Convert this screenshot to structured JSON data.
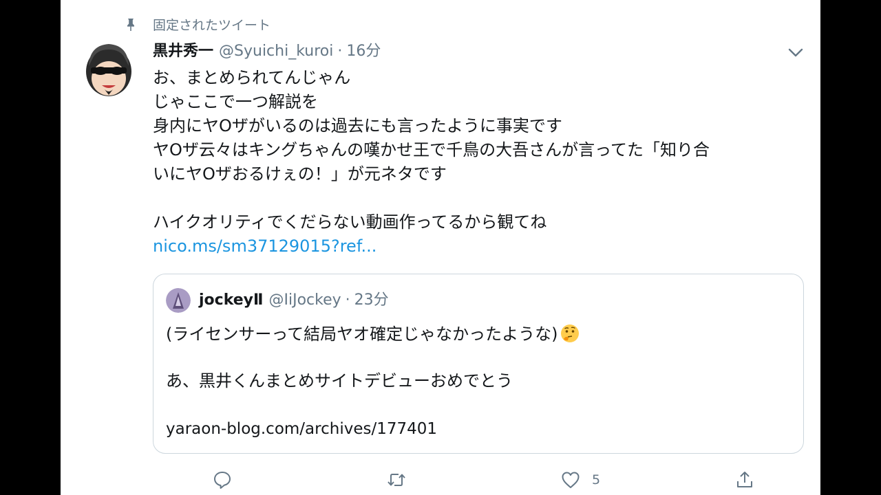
{
  "pinned_label": "固定されたツイート",
  "tweet": {
    "author_name": "黒井秀一",
    "author_handle": "@Syuichi_kuroi",
    "separator": "·",
    "time": "16分",
    "lines": [
      "お、まとめられてんじゃん",
      "じゃここで一つ解説を",
      "身内にヤOザがいるのは過去にも言ったように事実です",
      "ヤOザ云々はキングちゃんの嘆かせ王で千鳥の大吾さんが言ってた「知り合",
      "いにヤOザおるけぇの！」が元ネタです"
    ],
    "lines2": [
      "ハイクオリティでくだらない動画作ってるから観てね"
    ],
    "link": "nico.ms/sm37129015?ref..."
  },
  "quote": {
    "author_name": "jockeyⅡ",
    "author_handle": "@IiJockey",
    "separator": "·",
    "time": "23分",
    "line1": "(ライセンサーって結局ヤオ確定じゃなかったような)",
    "line1_emoji": "thinking-face-emoji",
    "line2": "あ、黒井くんまとめサイトデビューおめでとう",
    "url": "yaraon-blog.com/archives/177401"
  },
  "actions": {
    "reply_icon": "reply-icon",
    "retweet_icon": "retweet-icon",
    "like_icon": "like-icon",
    "like_count": "5",
    "share_icon": "share-icon"
  },
  "colors": {
    "text": "#14171a",
    "secondary": "#657786",
    "link": "#1b95e0",
    "border": "#ccd6dd"
  }
}
